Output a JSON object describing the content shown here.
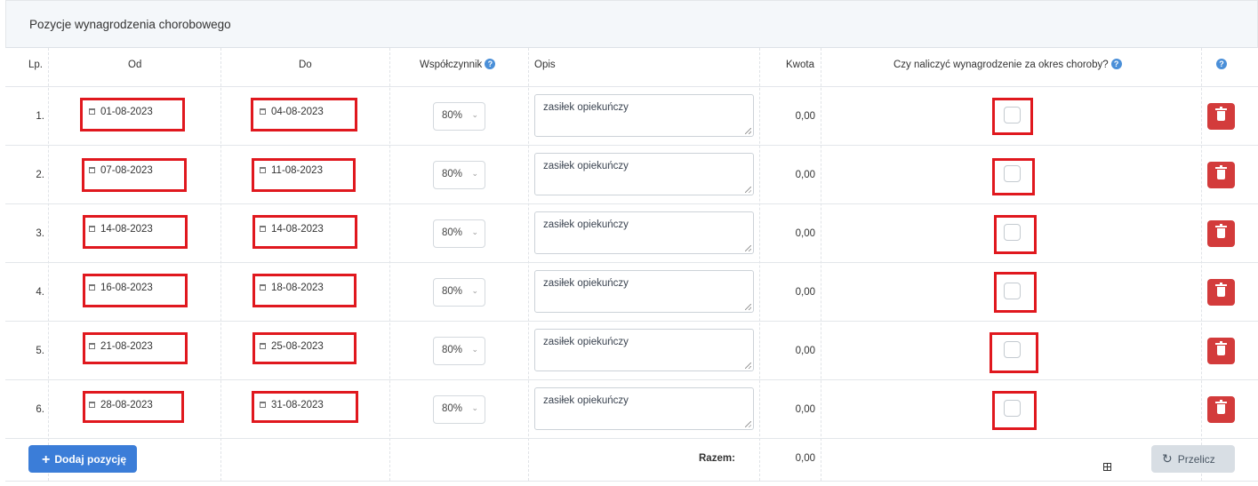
{
  "panel": {
    "title": "Pozycje wynagrodzenia chorobowego"
  },
  "columns": {
    "lp": "Lp.",
    "od": "Od",
    "do": "Do",
    "wspolczynnik": "Współczynnik",
    "opis": "Opis",
    "kwota": "Kwota",
    "naliczyc": "Czy naliczyć wynagrodzenie za okres choroby?",
    "help": "?"
  },
  "rows": [
    {
      "lp": "1.",
      "od": "01-08-2023",
      "do": "04-08-2023",
      "wspolczynnik": "80%",
      "opis": "zasiłek opiekuńczy",
      "kwota": "0,00",
      "naliczyc": false
    },
    {
      "lp": "2.",
      "od": "07-08-2023",
      "do": "11-08-2023",
      "wspolczynnik": "80%",
      "opis": "zasiłek opiekuńczy",
      "kwota": "0,00",
      "naliczyc": false
    },
    {
      "lp": "3.",
      "od": "14-08-2023",
      "do": "14-08-2023",
      "wspolczynnik": "80%",
      "opis": "zasiłek opiekuńczy",
      "kwota": "0,00",
      "naliczyc": false
    },
    {
      "lp": "4.",
      "od": "16-08-2023",
      "do": "18-08-2023",
      "wspolczynnik": "80%",
      "opis": "zasiłek opiekuńczy",
      "kwota": "0,00",
      "naliczyc": false
    },
    {
      "lp": "5.",
      "od": "21-08-2023",
      "do": "25-08-2023",
      "wspolczynnik": "80%",
      "opis": "zasiłek opiekuńczy",
      "kwota": "0,00",
      "naliczyc": false
    },
    {
      "lp": "6.",
      "od": "28-08-2023",
      "do": "31-08-2023",
      "wspolczynnik": "80%",
      "opis": "zasiłek opiekuńczy",
      "kwota": "0,00",
      "naliczyc": false
    }
  ],
  "footer": {
    "add_label": "Dodaj pozycję",
    "total_label": "Razem:",
    "total_value": "0,00",
    "recalc_label": "Przelicz"
  },
  "colors": {
    "accent": "#3b7dd8",
    "danger": "#d33b3b",
    "highlight": "#e0181e"
  },
  "icons": {
    "date": "calendar-icon",
    "delete": "trash-icon",
    "help": "help-icon",
    "add": "plus-icon",
    "recalc": "refresh-icon"
  }
}
